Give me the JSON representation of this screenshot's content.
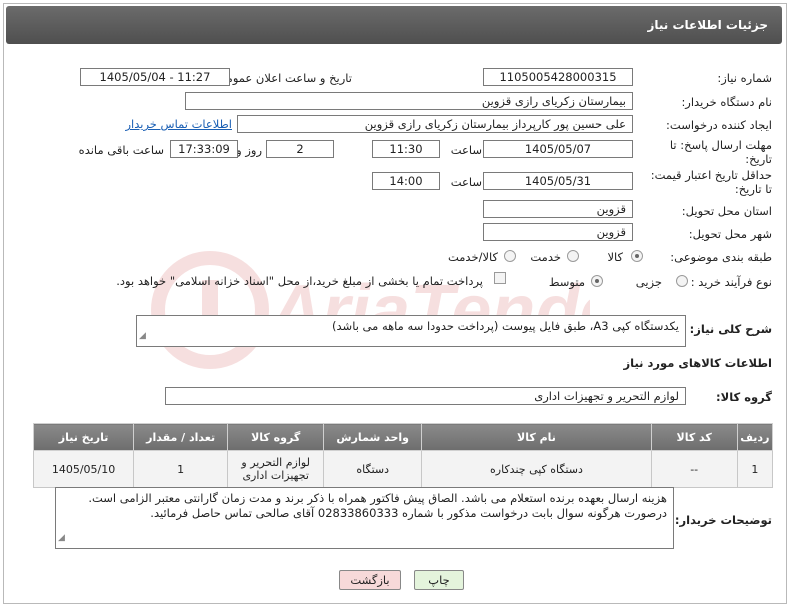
{
  "header": {
    "title": "جزئیات اطلاعات نیاز"
  },
  "form": {
    "need_number_label": "شماره نیاز:",
    "need_number": "1105005428000315",
    "announce_label": "تاریخ و ساعت اعلان عمومی:",
    "announce_value": "1405/05/04 - 11:27",
    "buyer_org_label": "نام دستگاه خریدار:",
    "buyer_org": "بیمارستان زکریای رازی قزوین",
    "creator_label": "ایجاد کننده درخواست:",
    "creator": "علی حسین پور کارپرداز بیمارستان زکریای رازی قزوین",
    "contact_link": "اطلاعات تماس خریدار",
    "deadline_label": "مهلت ارسال پاسخ: تا تاریخ:",
    "deadline_date": "1405/05/07",
    "time_label": "ساعت",
    "deadline_time": "11:30",
    "days_value": "2",
    "days_label": "روز و",
    "remaining_time": "17:33:09",
    "remaining_label": "ساعت باقی مانده",
    "validity_label": "حداقل تاریخ اعتبار قیمت: تا تاریخ:",
    "validity_date": "1405/05/31",
    "validity_time": "14:00",
    "province_label": "استان محل تحویل:",
    "province": "قزوین",
    "city_label": "شهر محل تحویل:",
    "city": "قزوین",
    "category_label": "طبقه بندی موضوعی:",
    "category_options": [
      "کالا",
      "خدمت",
      "کالا/خدمت"
    ],
    "process_label": "نوع فرآیند خرید :",
    "process_options": [
      "جزیی",
      "متوسط"
    ],
    "payment_note": "پرداخت تمام یا بخشی از مبلغ خرید،از محل \"اسناد خزانه اسلامی\" خواهد بود.",
    "description_label": "شرح کلی نیاز:",
    "description": "یکدستگاه کپی A3، طبق فایل پیوست (پرداخت حدودا سه ماهه می باشد)",
    "goods_info_label": "اطلاعات کالاهای مورد نیاز",
    "goods_group_label": "گروه کالا:",
    "goods_group": "لوازم التحریر و تجهیزات اداری"
  },
  "table": {
    "headers": [
      "ردیف",
      "کد کالا",
      "نام کالا",
      "واحد شمارش",
      "گروه کالا",
      "تعداد / مقدار",
      "تاریخ نیاز"
    ],
    "rows": [
      [
        "1",
        "--",
        "دستگاه کپی چندکاره",
        "دستگاه",
        "لوازم التحریر و تجهیزات اداری",
        "1",
        "1405/05/10"
      ]
    ]
  },
  "notes": {
    "label": "توضیحات خریدار:",
    "line1": "هزینه ارسال بعهده برنده استعلام می باشد. الصاق پیش فاکتور همراه با ذکر برند و مدت زمان گارانتی معتبر الزامی است.",
    "line2": "درصورت هرگونه سوال بابت درخواست مذکور با شماره 02833860333 آقای صالحی تماس حاصل فرمائید."
  },
  "buttons": {
    "print": "چاپ",
    "back": "بازگشت"
  },
  "colors": {
    "header_bg": "#5a5a5a",
    "link": "#1a5fb4",
    "back_btn_bg": "#f7d9d9",
    "print_btn_bg": "#e4f4dc"
  }
}
